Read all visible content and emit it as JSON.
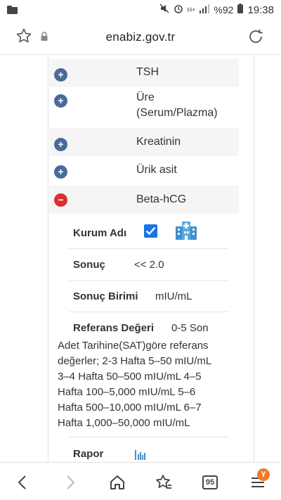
{
  "status_bar": {
    "battery": "%92",
    "time": "19:38",
    "network": "H+"
  },
  "browser": {
    "domain": "enabiz.gov.tr"
  },
  "tests": [
    {
      "name": "TSH"
    },
    {
      "name": "Üre"
    },
    {
      "name": "(Serum/Plazma)"
    },
    {
      "name": "Kreatinin"
    },
    {
      "name": "Ürik asit"
    },
    {
      "name": "Beta-hCG"
    }
  ],
  "detail": {
    "kurum_label": "Kurum Adı",
    "sonuc_label": "Sonuç",
    "sonuc_value": "<< 2.0",
    "birim_label": "Sonuç Birimi",
    "birim_value": "mIU/mL",
    "referans_label": "Referans Değeri",
    "referans_first": "0-5 Son",
    "referans_lines": [
      "Adet Tarihine(SAT)göre referans",
      "değerler; 2-3 Hafta 5–50 mIU/mL",
      "3–4 Hafta 50–500 mIU/mL 4–5",
      "Hafta 100–5,000 mIU/mL 5–6",
      "Hafta 500–10,000 mIU/mL 6–7",
      "Hafta 1,000–50,000 mIU/mL"
    ],
    "rapor_label": "Rapor"
  },
  "bottom_nav": {
    "tab_count": "95",
    "badge": "Y"
  },
  "colors": {
    "plus_blue": "#4a6a9c",
    "minus_red": "#d93030",
    "checkbox_blue": "#1a73e8",
    "badge_orange": "#f27a2b"
  }
}
